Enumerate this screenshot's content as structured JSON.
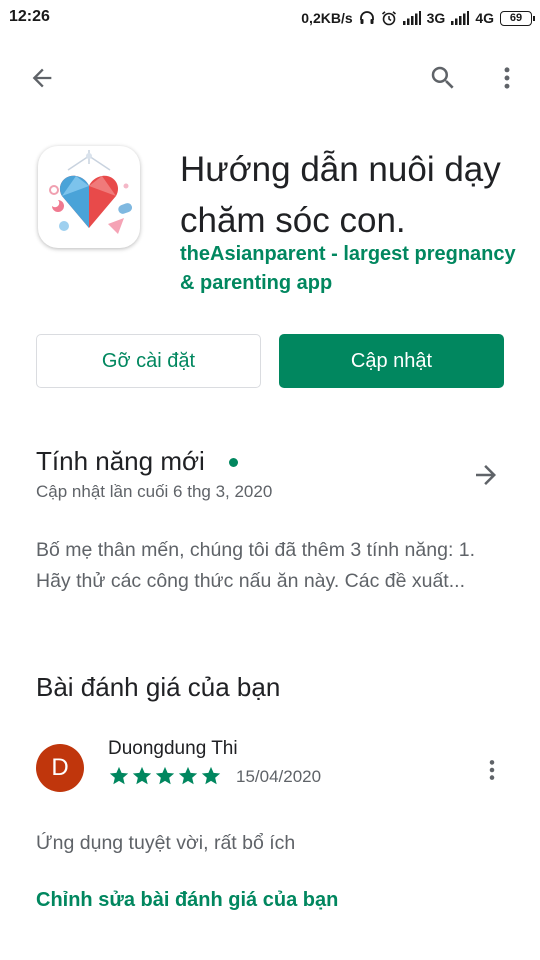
{
  "status_bar": {
    "time": "12:26",
    "network_speed": "0,2KB/s",
    "network_type_1": "3G",
    "network_type_2": "4G",
    "battery": "69"
  },
  "app": {
    "title": "Hướng dẫn nuôi dạy chăm sóc con.",
    "developer": "theAsianparent - largest pregnancy & parenting app"
  },
  "actions": {
    "uninstall_label": "Gỡ cài đặt",
    "update_label": "Cập nhật"
  },
  "whats_new": {
    "title": "Tính năng mới",
    "updated": "Cập nhật lần cuối 6 thg 3, 2020",
    "body": "Bố mẹ thân mến, chúng tôi đã thêm 3 tính năng: 1. Hãy thử các công thức nấu ăn này. Các đề xuất..."
  },
  "review": {
    "section_title": "Bài đánh giá của bạn",
    "avatar_letter": "D",
    "author": "Duongdung Thi",
    "rating": 5,
    "date": "15/04/2020",
    "text": "Ứng dụng tuyệt vời, rất bổ ích",
    "edit_label": "Chỉnh sửa bài đánh giá của bạn"
  },
  "colors": {
    "accent": "#01875f",
    "avatar": "#c0360c",
    "secondary_text": "#5f6368"
  },
  "icons": [
    "back-arrow-icon",
    "search-icon",
    "more-vert-icon",
    "arrow-forward-icon",
    "star-icon",
    "headphones-icon",
    "alarm-icon",
    "signal-icon"
  ]
}
